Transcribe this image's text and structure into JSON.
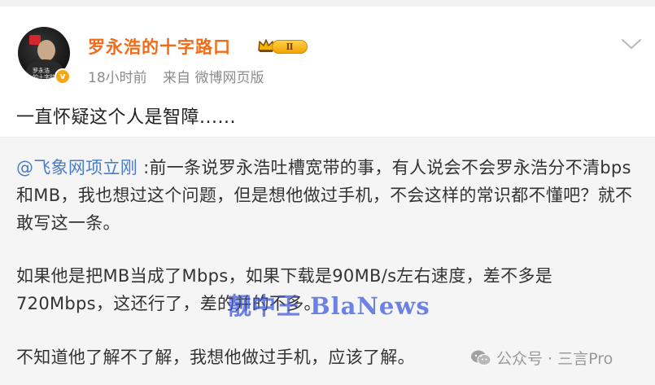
{
  "post": {
    "author": "罗永浩的十字路口",
    "level": "Ⅱ",
    "time": "18小时前",
    "source": "来自 微博网页版",
    "text": "一直怀疑这个人是智障......",
    "avatar_caption": "罗永浩\n的十字路口"
  },
  "repost": {
    "mention": "@飞象网项立刚",
    "para1": " :前一条说罗永浩吐槽宽带的事，有人说会不会罗永浩分不清bps和MB，我也想过这个问题，但是想他做过手机，不会这样的常识都不懂吧？就不敢写这一条。",
    "para2": "如果他是把MB当成了Mbps，如果下载是90MB/s左右速度，差不多是720Mbps，这还行了，差的并的不多。",
    "para3": "不知道他了解不了解，我想他做过手机，应该了解。"
  },
  "watermark": {
    "overlay": "靓中王 BlaNews",
    "footer": "公众号 · 三言Pro"
  },
  "colors": {
    "username": "#f26b16",
    "mention": "#4a7cc7",
    "repost_bg": "#f5f5f5"
  },
  "icons": [
    "verified-badge-icon",
    "crown-level-icon",
    "chevron-down-icon",
    "wechat-icon"
  ]
}
